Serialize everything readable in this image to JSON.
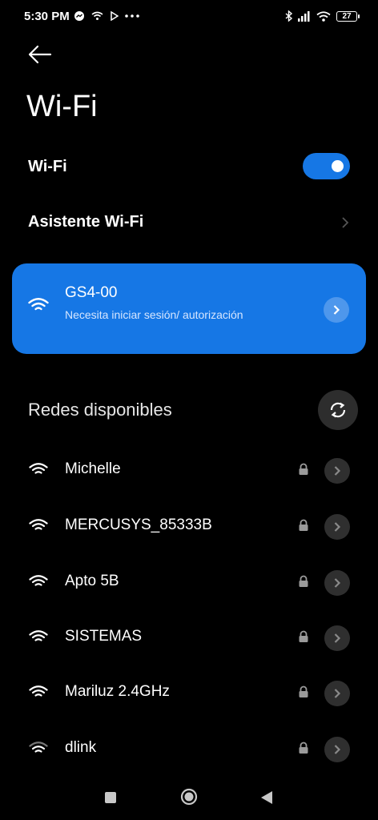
{
  "status_bar": {
    "time": "5:30 PM",
    "battery": "27"
  },
  "header": {
    "title": "Wi-Fi"
  },
  "wifi_toggle": {
    "label": "Wi-Fi",
    "on": true
  },
  "assistant": {
    "label": "Asistente Wi-Fi"
  },
  "connected": {
    "name": "GS4-00",
    "status": "Necesita iniciar sesión/ autorización"
  },
  "available": {
    "title": "Redes disponibles",
    "networks": [
      {
        "name": "Michelle"
      },
      {
        "name": "MERCUSYS_85333B"
      },
      {
        "name": "Apto 5B"
      },
      {
        "name": "SISTEMAS"
      },
      {
        "name": "Mariluz 2.4GHz"
      },
      {
        "name": "dlink"
      }
    ]
  },
  "colors": {
    "accent": "#1677e5",
    "background": "#000000"
  }
}
